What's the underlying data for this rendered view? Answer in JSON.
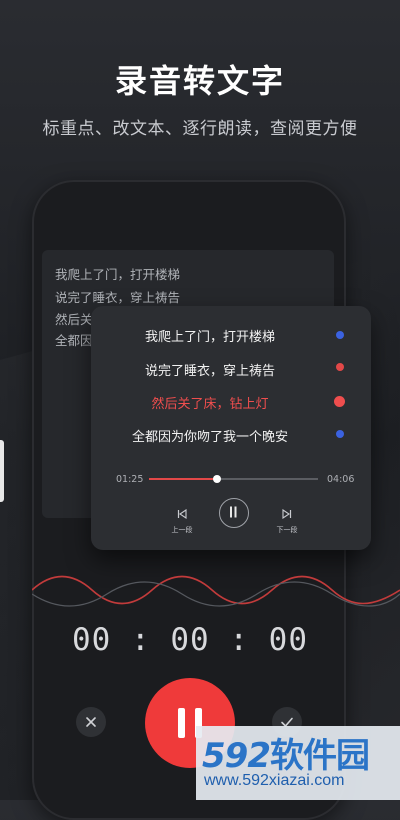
{
  "header": {
    "title": "录音转文字",
    "subtitle": "标重点、改文本、逐行朗读，查阅更方便"
  },
  "background_lyrics": [
    "我爬上了门，打开楼梯",
    "说完了睡衣，穿上祷告",
    "然后关",
    "全都因"
  ],
  "overlay": {
    "lines": [
      {
        "text": "我爬上了门，打开楼梯",
        "marker_color": "#3b62e0"
      },
      {
        "text": "说完了睡衣，穿上祷告",
        "marker_color": "#e24848"
      },
      {
        "text": "然后关了床，钻上灯",
        "marker_color": "#ef4e4e",
        "active": true
      },
      {
        "text": "全都因为你吻了我一个晚安",
        "marker_color": "#3b62e0"
      }
    ],
    "time_elapsed": "01:25",
    "time_total": "04:06",
    "progress_fraction": 0.4,
    "prev_label": "上一段",
    "next_label": "下一段"
  },
  "timer": "00 : 00 : 00",
  "colors": {
    "accent_red": "#ef3a3a",
    "marker_blue": "#3b62e0"
  },
  "icons": {
    "cancel": "close-icon",
    "record": "pause-icon",
    "confirm": "check-icon",
    "prev": "skip-previous-icon",
    "next": "skip-next-icon",
    "playpause": "pause-icon"
  },
  "watermark": {
    "number": "592",
    "brand": "软件园",
    "url": "www.592xiazai.com"
  }
}
